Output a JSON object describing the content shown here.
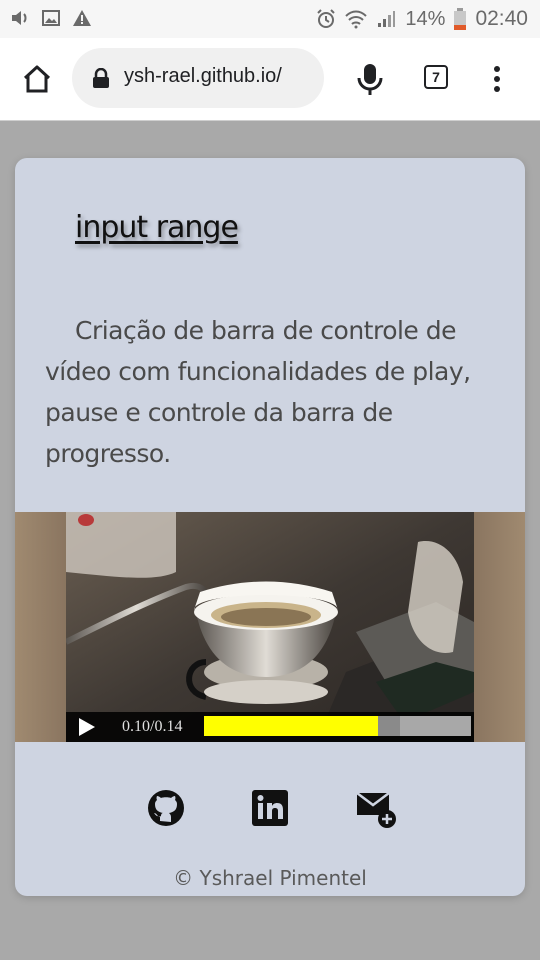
{
  "status_bar": {
    "battery": "14%",
    "time": "02:40",
    "icons": [
      "volume-icon",
      "image-icon",
      "warning-icon",
      "alarm-icon",
      "wifi-icon",
      "signal-icon",
      "battery-icon"
    ]
  },
  "browser": {
    "url": "ysh-rael.github.io/",
    "tab_count": "7",
    "icons": [
      "home-icon",
      "lock-icon",
      "mic-icon",
      "tabs-icon",
      "menu-dots-icon"
    ]
  },
  "card": {
    "title": "input range",
    "description": "Criação de barra de controle de vídeo com funcionalidades de play, pause e controle da barra de progresso.",
    "video": {
      "time": "0.10/0.14",
      "progress": 0.71,
      "accent_color": "#ffff00"
    },
    "socials": [
      "github-icon",
      "linkedin-icon",
      "email-add-icon"
    ],
    "footer": "© Yshrael Pimentel"
  },
  "colors": {
    "page_background": "#a9a9a9",
    "card_background": "#ced4e1"
  }
}
